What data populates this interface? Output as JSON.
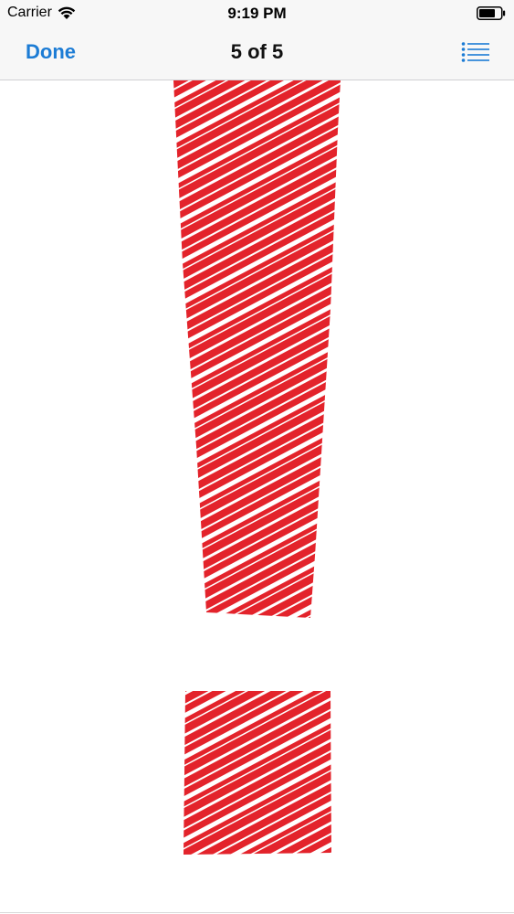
{
  "status_bar": {
    "carrier": "Carrier",
    "time": "9:19 PM"
  },
  "nav_bar": {
    "done_label": "Done",
    "title": "5 of 5",
    "list_icon": "list-icon"
  },
  "content": {
    "image": "red-scribbled-exclamation-mark",
    "colors": {
      "mark": "#e3232b",
      "background": "#ffffff",
      "accent": "#1c7cd5"
    }
  }
}
